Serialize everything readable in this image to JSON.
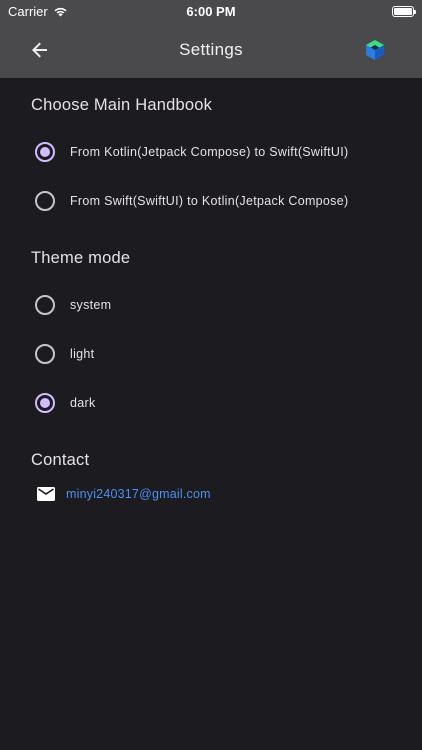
{
  "status_bar": {
    "carrier": "Carrier",
    "time": "6:00 PM",
    "battery_level": 1.0
  },
  "app_bar": {
    "title": "Settings",
    "back_icon": "arrow-back-icon",
    "logo_icon": "app-logo-icon"
  },
  "handbook": {
    "title": "Choose Main Handbook",
    "options": [
      {
        "label": "From Kotlin(Jetpack Compose) to Swift(SwiftUI)",
        "selected": true
      },
      {
        "label": "From Swift(SwiftUI) to Kotlin(Jetpack Compose)",
        "selected": false
      }
    ]
  },
  "theme": {
    "title": "Theme mode",
    "options": [
      {
        "label": "system",
        "selected": false
      },
      {
        "label": "light",
        "selected": false
      },
      {
        "label": "dark",
        "selected": true
      }
    ]
  },
  "contact": {
    "title": "Contact",
    "email": "minyi240317@gmail.com",
    "icon": "mail-icon"
  },
  "colors": {
    "background": "#1c1b1f",
    "app_bar": "#4a4a4c",
    "accent": "#d0bcff",
    "link": "#4d8ff2"
  }
}
